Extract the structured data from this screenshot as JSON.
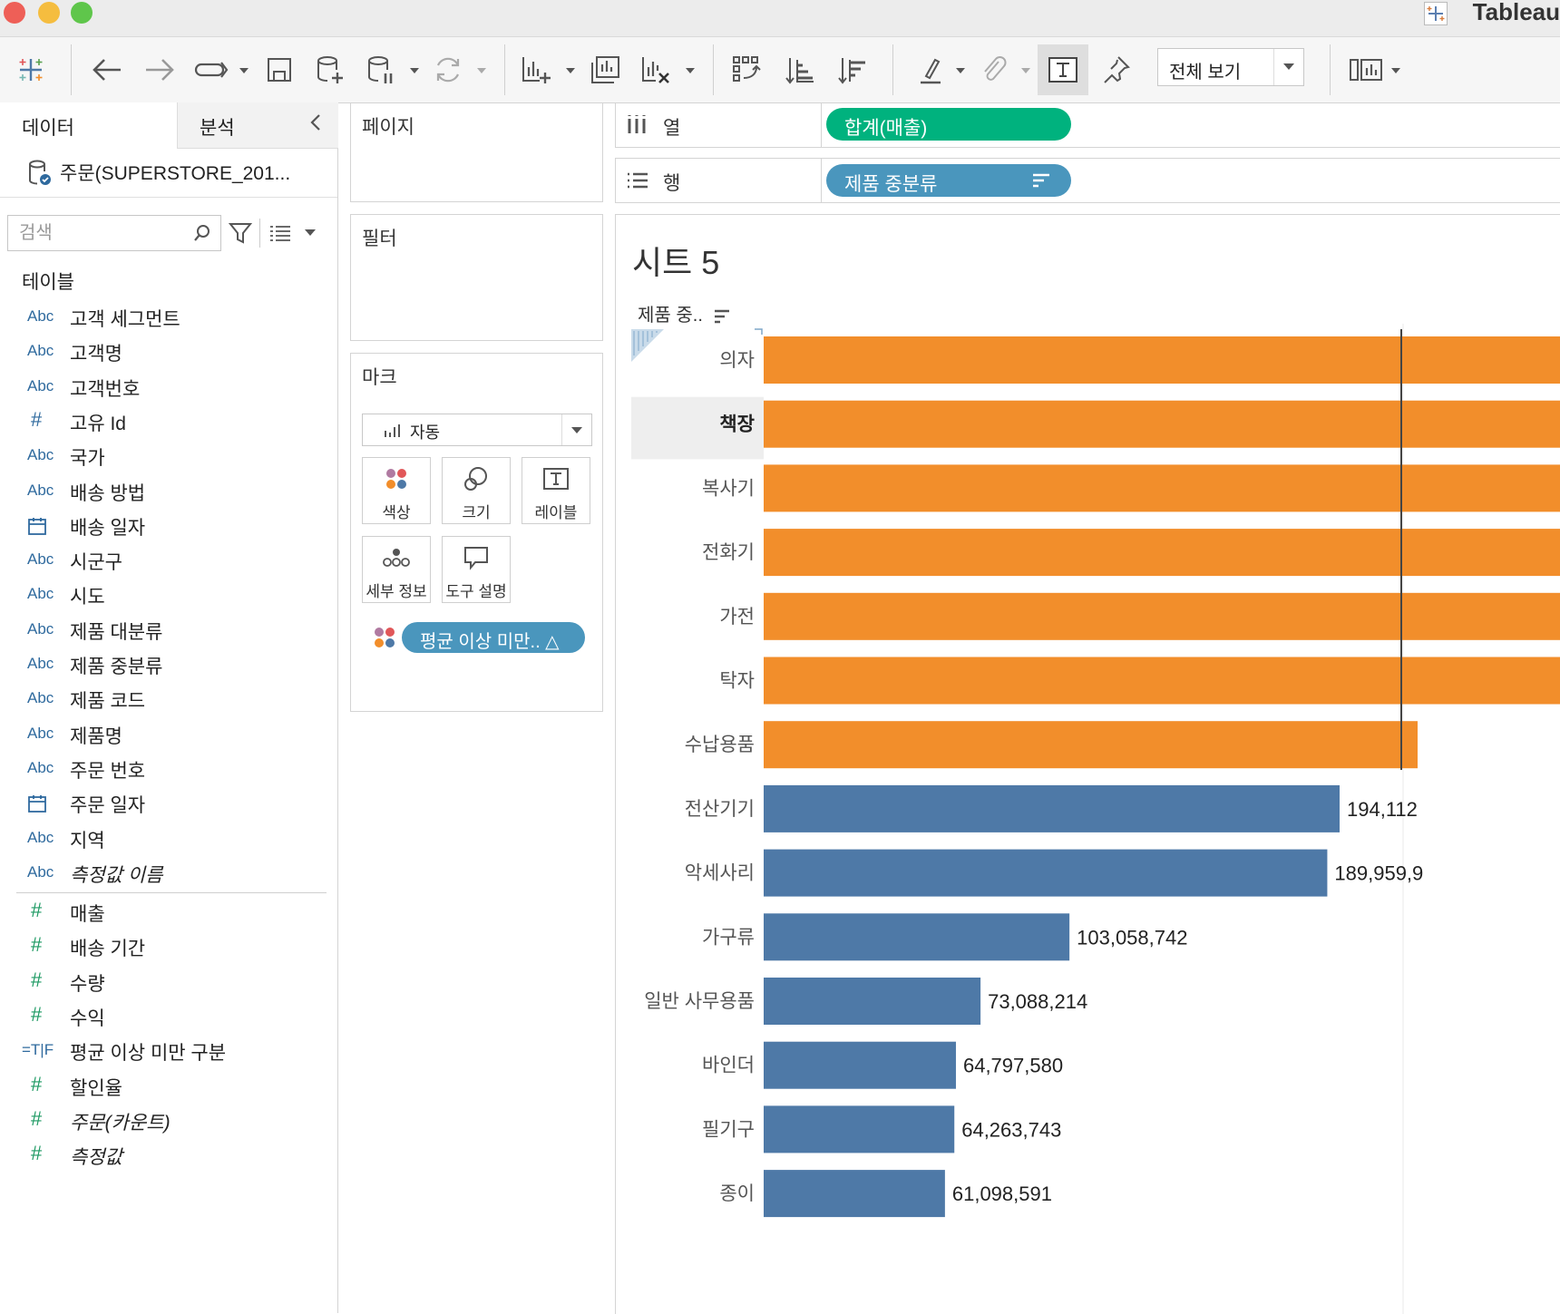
{
  "window": {
    "title": "Tableau"
  },
  "toolbar": {
    "view_mode": "전체 보기"
  },
  "data_pane": {
    "tabs": [
      "데이터",
      "분석"
    ],
    "datasource": "주문(SUPERSTORE_201...",
    "search_placeholder": "검색",
    "tables_heading": "테이블",
    "dimensions": [
      {
        "type": "Abc",
        "name": "고객 세그먼트"
      },
      {
        "type": "Abc",
        "name": "고객명"
      },
      {
        "type": "Abc",
        "name": "고객번호"
      },
      {
        "type": "#",
        "name": "고유 Id"
      },
      {
        "type": "Abc",
        "name": "국가"
      },
      {
        "type": "Abc",
        "name": "배송 방법"
      },
      {
        "type": "date",
        "name": "배송 일자"
      },
      {
        "type": "Abc",
        "name": "시군구"
      },
      {
        "type": "Abc",
        "name": "시도"
      },
      {
        "type": "Abc",
        "name": "제품 대분류"
      },
      {
        "type": "Abc",
        "name": "제품 중분류"
      },
      {
        "type": "Abc",
        "name": "제품 코드"
      },
      {
        "type": "Abc",
        "name": "제품명"
      },
      {
        "type": "Abc",
        "name": "주문 번호"
      },
      {
        "type": "date",
        "name": "주문 일자"
      },
      {
        "type": "Abc",
        "name": "지역"
      },
      {
        "type": "Abc",
        "name": "측정값 이름",
        "italic": true
      }
    ],
    "measures": [
      {
        "type": "#",
        "name": "매출"
      },
      {
        "type": "#",
        "name": "배송 기간"
      },
      {
        "type": "#",
        "name": "수량"
      },
      {
        "type": "#",
        "name": "수익"
      },
      {
        "type": "=T|F",
        "name": "평균 이상 미만 구분"
      },
      {
        "type": "#",
        "name": "할인율"
      },
      {
        "type": "#",
        "name": "주문(카운트)",
        "italic": true
      },
      {
        "type": "#",
        "name": "측정값",
        "italic": true
      }
    ]
  },
  "cards": {
    "pages": "페이지",
    "filters": "필터",
    "marks": {
      "title": "마크",
      "type": "자동",
      "buttons": [
        "색상",
        "크기",
        "레이블",
        "세부 정보",
        "도구 설명"
      ],
      "color_pill": "평균 이상 미만.. △"
    }
  },
  "shelves": {
    "columns_label": "열",
    "columns_pill": "합계(매출)",
    "rows_label": "행",
    "rows_pill": "제품 중분류"
  },
  "sheet": {
    "title": "시트 5",
    "row_header": "제품 중.."
  },
  "colors": {
    "above_avg": "#f28e2b",
    "below_avg": "#4e79a7",
    "accent": "#00b27e",
    "pill": "#4a96bd"
  },
  "chart_data": {
    "type": "bar",
    "orientation": "horizontal",
    "categories": [
      "의자",
      "책장",
      "복사기",
      "전화기",
      "가전",
      "탁자",
      "수납용품",
      "전산기기",
      "악세사리",
      "가구류",
      "일반 사무용품",
      "바인더",
      "필기구",
      "종이"
    ],
    "values": [
      null,
      null,
      null,
      null,
      null,
      null,
      null,
      194112000,
      189959900,
      103058742,
      73088214,
      64797580,
      64263743,
      61098591
    ],
    "value_labels": [
      "",
      "",
      "",
      "",
      "",
      "",
      "",
      "194,112",
      "189,959,9",
      "103,058,742",
      "73,088,214",
      "64,797,580",
      "64,263,743",
      "61,098,591"
    ],
    "group": [
      "above",
      "above",
      "above",
      "above",
      "above",
      "above",
      "above",
      "below",
      "below",
      "below",
      "below",
      "below",
      "below",
      "below"
    ],
    "highlighted_row": "책장"
  }
}
